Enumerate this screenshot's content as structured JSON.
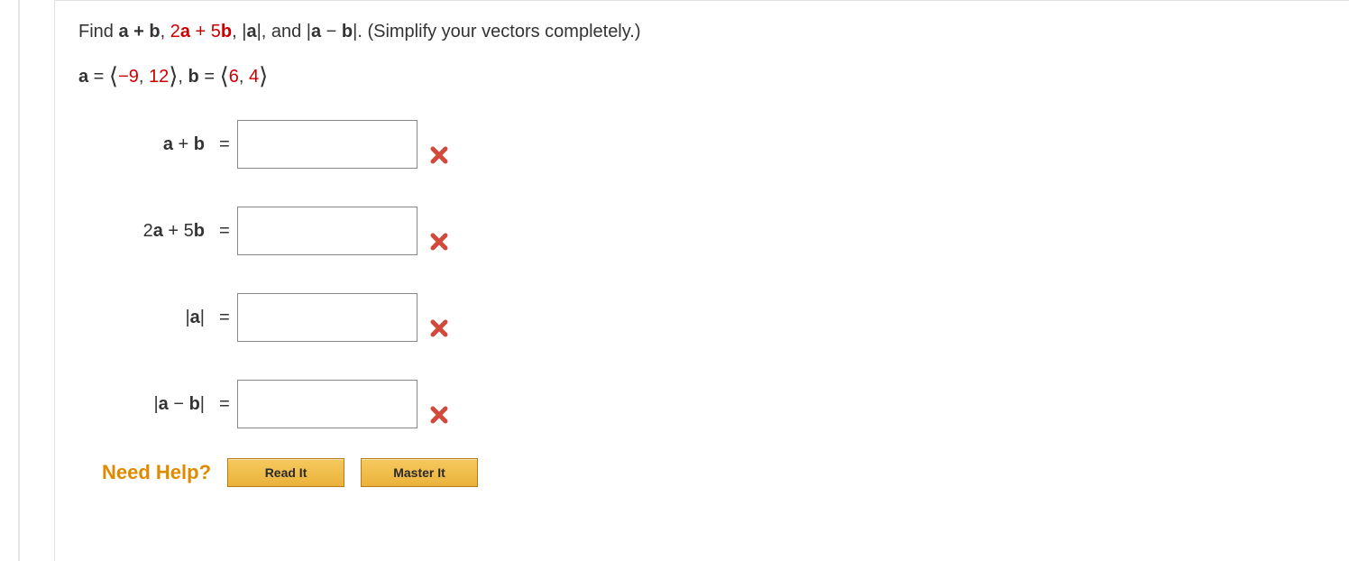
{
  "prompt": {
    "t1": "Find ",
    "ab": "a + b",
    "c1": ", ",
    "expr2a": "2",
    "exprA": "a",
    "exprPlus": " + ",
    "expr5": "5",
    "exprB": "b",
    "c2": ", |",
    "absA": "a",
    "c3": "|, and |",
    "absA2": "a",
    "minus": " − ",
    "absB": "b",
    "c4": "|. (Simplify your vectors completely.)"
  },
  "given": {
    "aLabel": "a",
    "eq": " = ",
    "aLL": "⟨",
    "aV1": "−9",
    "aComma": ", ",
    "aV2": "12",
    "aRR": "⟩",
    "sep": ",    ",
    "bLabel": "b",
    "bLL": "⟨",
    "bV1": "6",
    "bV2": "4",
    "bRR": "⟩"
  },
  "rows": {
    "r1": {
      "lblA": "a",
      "plus": " + ",
      "lblB": "b",
      "value": ""
    },
    "r2": {
      "two": "2",
      "lblA": "a",
      "plus": " + ",
      "five": "5",
      "lblB": "b",
      "value": ""
    },
    "r3": {
      "bar1": "|",
      "lblA": "a",
      "bar2": "|",
      "value": ""
    },
    "r4": {
      "bar1": "|",
      "lblA": "a",
      "minus": " − ",
      "lblB": "b",
      "bar2": "|",
      "value": ""
    }
  },
  "eq": "=",
  "help": {
    "label": "Need Help?",
    "read": "Read It",
    "master": "Master It"
  }
}
